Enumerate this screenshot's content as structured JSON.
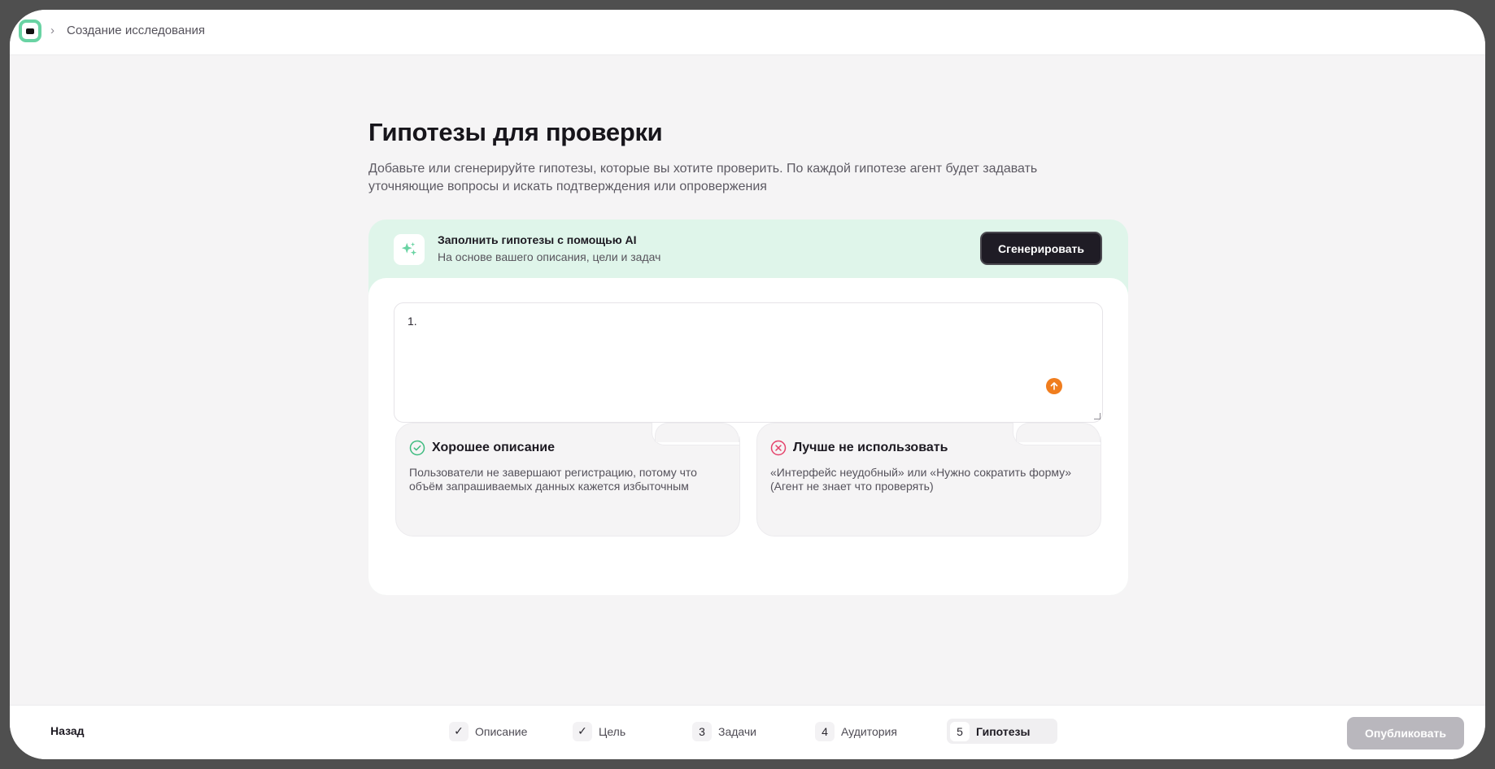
{
  "breadcrumb": {
    "current": "Создание исследования"
  },
  "page": {
    "title": "Гипотезы для проверки",
    "subtitle": "Добавьте или сгенерируйте гипотезы, которые вы хотите проверить. По каждой гипотезе агент будет задавать уточняющие вопросы и искать подтверждения или опровержения"
  },
  "ai_banner": {
    "title": "Заполнить гипотезы с помощью AI",
    "subtitle": "На основе вашего описания, цели и задач",
    "button_label": "Сгенерировать"
  },
  "hypotheses_input": {
    "value": "1."
  },
  "examples": {
    "good": {
      "title": "Хорошее описание",
      "text": "Пользователи не завершают регистрацию, потому что объём запрашиваемых данных кажется избыточным"
    },
    "bad": {
      "title": "Лучше не использовать",
      "text": "«Интерфейс неудобный» или «Нужно сократить форму» (Агент не знает что проверять)"
    }
  },
  "footer": {
    "back_label": "Назад",
    "steps": [
      {
        "mark": "✓",
        "label": "Описание"
      },
      {
        "mark": "✓",
        "label": "Цель"
      },
      {
        "mark": "3",
        "label": "Задачи"
      },
      {
        "mark": "4",
        "label": "Аудитория"
      },
      {
        "mark": "5",
        "label": "Гипотезы"
      }
    ],
    "publish_label": "Опубликовать"
  },
  "colors": {
    "accent_green": "#69d3a3",
    "banner_bg": "#dff5ea",
    "primary_button": "#1f1c25",
    "upload_orange": "#f07d1e",
    "good_green": "#3dbb7f",
    "bad_red": "#e5426b",
    "disabled_button": "#b9b7bd"
  },
  "icons": {
    "logo": "app-logo-icon",
    "ai": "sparkles-icon",
    "upload": "arrow-up-icon",
    "good": "check-circle-icon",
    "bad": "x-circle-icon"
  }
}
